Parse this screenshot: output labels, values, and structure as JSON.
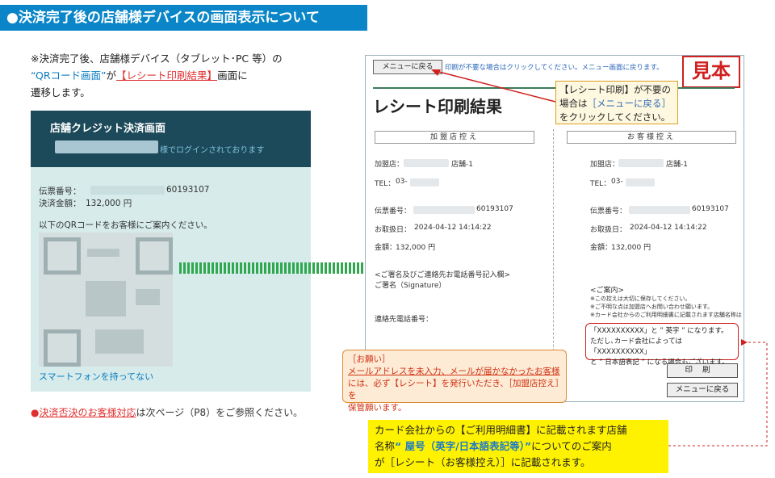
{
  "header": {
    "title": "●決済完了後の店舗様デバイスの画面表示について"
  },
  "intro": {
    "line1": "※決済完了後、店舗様デバイス（タブレット･PC 等）の",
    "line2_a": "“QRコード画面”",
    "line2_b": "が",
    "line2_c": "【レシート印刷結果】",
    "line2_d": "画面に",
    "line3": "遷移します。"
  },
  "device": {
    "title": "店舗クレジット決済画面",
    "login_suffix": "様でログインされております",
    "slip_label": "伝票番号：",
    "slip_tail": "60193107",
    "amount_label": "決済金額：",
    "amount_value": "132,000 円",
    "qr_guide": "以下のQRコードをお客様にご案内ください。",
    "no_phone_link": "スマートフォンを持ってない"
  },
  "left_note": {
    "dot": "●",
    "link": "決済否決のお客様対応",
    "rest": "は次ページ（P8）をご参照ください。"
  },
  "receipt": {
    "menu_button": "メニューに戻る",
    "menu_note": "印刷が不要な場合はクリックしてください。メニュー画面に戻ります。",
    "sample_stamp": "見本",
    "title": "レシート印刷結果",
    "callout": {
      "l1": "【レシート印刷】が不要の",
      "l2a": "場合は",
      "l2b": "［メニューに戻る］",
      "l3": "をクリックしてください。"
    },
    "merchant_copy": "加盟店控え",
    "customer_copy": "お客様控え",
    "shop_label": "加盟店：",
    "shop_suffix": "店舗-1",
    "tel_label": "TEL：",
    "tel_prefix": "03-",
    "slip_label": "伝票番号：",
    "slip_tail": "60193107",
    "date_label": "お取扱日：",
    "date_value": "2024-04-12 14:14:22",
    "amount_label": "金額：",
    "amount_value": "132,000 円",
    "signature_field_a": "<ご署名及びご連絡先お電話番号記入欄>",
    "signature_field_b": "ご署名（Signature）",
    "phone_field": "連絡先電話番号：",
    "guide_title": "<ご案内>",
    "guide_1": "※この控えは大切に保存してください。",
    "guide_2": "※ご不明な点は加盟店へお問い合わせ願います。",
    "guide_3": "※カード会社からのご利用明細書に記載されます店舗名称は",
    "name_box_1": "「XXXXXXXXXX」と ” 英字 ” になります。",
    "name_box_2": "ただし､カード会社によっては「XXXXXXXXXX」",
    "name_box_3": "と ” 日本語表記 ” になる場合もございます。",
    "print_button": "印刷",
    "menu_button2": "メニューに戻る"
  },
  "request_box": {
    "title": "［お願い］",
    "l1": "メールアドレスを未入力、メールが届かなかったお客様",
    "l2": "には、必ず【レシート】を発行いただき、［加盟店控え］を",
    "l3": "保管願います。"
  },
  "bottom_note": {
    "l1": "カード会社からの【ご利用明細書】に記載されます店舗",
    "l2a": "名称",
    "l2b": "“ 屋号（英字/日本語表記等）”",
    "l2c": "についてのご案内",
    "l3": "が［レシート（お客様控え）］に記載されます。"
  },
  "colors": {
    "header_blue": "#0a86c8",
    "accent_red": "#d02020",
    "panel_dark": "#1d4a5a",
    "arrow_green": "#2fa84f",
    "highlight_yellow": "#fff200"
  }
}
